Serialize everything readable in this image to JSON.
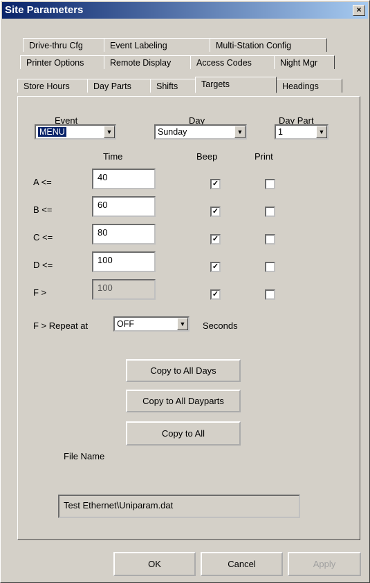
{
  "window": {
    "title": "Site Parameters",
    "close_label": "×"
  },
  "tabs": {
    "row1": [
      "Drive-thru Cfg",
      "Event Labeling",
      "Multi-Station Config"
    ],
    "row2": [
      "Printer Options",
      "Remote Display",
      "Access Codes",
      "Night Mgr"
    ],
    "row3": [
      "Store Hours",
      "Day Parts",
      "Shifts",
      "Targets",
      "Headings"
    ],
    "active": "Targets"
  },
  "selectors": {
    "event": {
      "label": "Event",
      "value": "MENU"
    },
    "day": {
      "label": "Day",
      "value": "Sunday"
    },
    "day_part": {
      "label": "Day Part",
      "value": "1"
    }
  },
  "columns": {
    "time": "Time",
    "beep": "Beep",
    "print": "Print"
  },
  "targets": [
    {
      "label": "A <=",
      "time": "40",
      "beep": true,
      "print": false,
      "disabled": false
    },
    {
      "label": "B <=",
      "time": "60",
      "beep": true,
      "print": false,
      "disabled": false
    },
    {
      "label": "C <=",
      "time": "80",
      "beep": true,
      "print": false,
      "disabled": false
    },
    {
      "label": "D <=",
      "time": "100",
      "beep": true,
      "print": false,
      "disabled": false
    },
    {
      "label": "F >",
      "time": "100",
      "beep": true,
      "print": false,
      "disabled": true
    }
  ],
  "repeat": {
    "label": "F > Repeat at",
    "value": "OFF",
    "unit": "Seconds"
  },
  "buttons": {
    "copy_days": "Copy to All Days",
    "copy_dayparts": "Copy to All Dayparts",
    "copy_all": "Copy to All"
  },
  "file": {
    "label": "File Name",
    "value": "Test Ethernet\\Uniparam.dat"
  },
  "footer": {
    "ok": "OK",
    "cancel": "Cancel",
    "apply": "Apply"
  },
  "checkmark": "✓"
}
